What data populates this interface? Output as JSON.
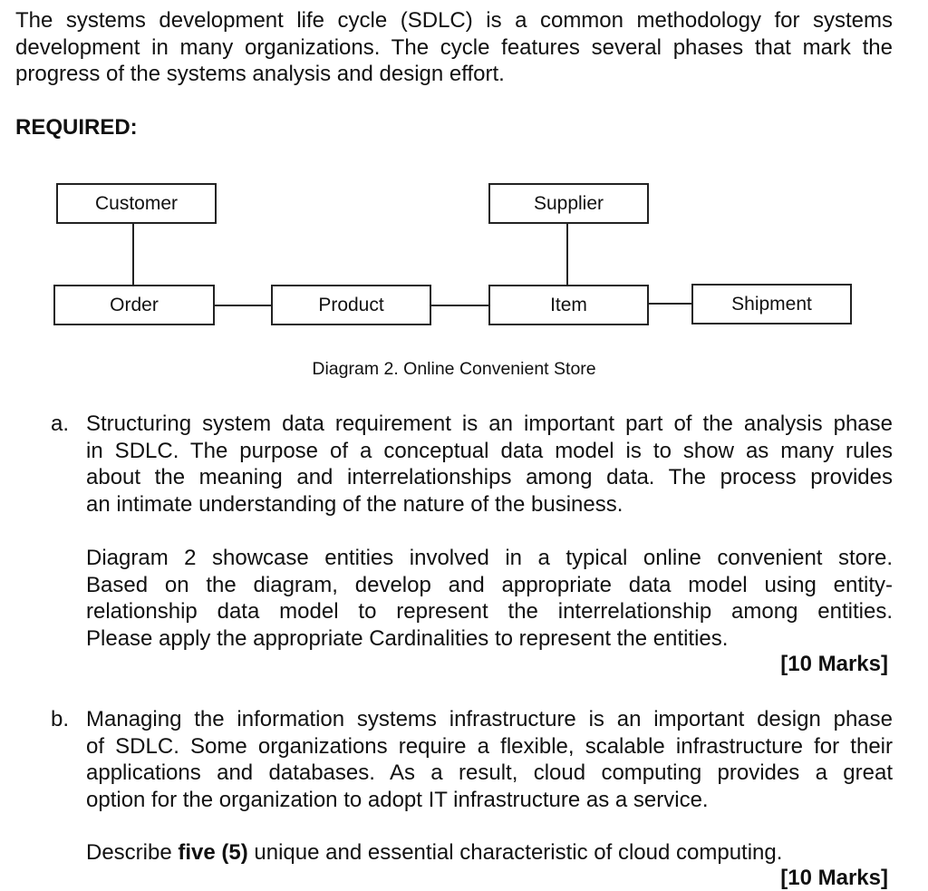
{
  "intro": {
    "line1": "The systems development life cycle (SDLC) is a common methodology for systems",
    "line2": "development in many organizations. The cycle features several phases that mark the",
    "line3": "progress of the systems analysis and design effort."
  },
  "required_heading": "REQUIRED:",
  "diagram": {
    "entities": {
      "customer": "Customer",
      "supplier": "Supplier",
      "order": "Order",
      "product": "Product",
      "item": "Item",
      "shipment": "Shipment"
    },
    "relationships": [
      [
        "Customer",
        "Order"
      ],
      [
        "Order",
        "Product"
      ],
      [
        "Product",
        "Item"
      ],
      [
        "Supplier",
        "Item"
      ],
      [
        "Item",
        "Shipment"
      ]
    ],
    "caption": "Diagram 2. Online Convenient Store"
  },
  "question_a": {
    "label": "a.",
    "para1": {
      "line1": "Structuring system data requirement is an important part of the analysis phase",
      "line2": "in SDLC. The purpose of a conceptual data model is to show as many rules",
      "line3": "about the meaning and interrelationships among data. The process provides",
      "line4": "an intimate understanding of the nature of the business."
    },
    "para2": {
      "line1": "Diagram 2 showcase entities involved in a typical online convenient store.",
      "line2": "Based on the diagram, develop and appropriate data model using entity-",
      "line3": "relationship data model to represent the interrelationship among entities.",
      "line4": "Please apply the appropriate Cardinalities to represent the entities."
    },
    "marks": "[10 Marks]"
  },
  "question_b": {
    "label": "b.",
    "para1": {
      "line1": "Managing the information systems infrastructure is an important design phase",
      "line2": "of SDLC. Some organizations require a flexible, scalable infrastructure for their",
      "line3": "applications and databases. As a result, cloud computing provides a great",
      "line4": "option for the organization to adopt IT infrastructure as a service."
    },
    "para2": {
      "prefix": "Describe ",
      "bold": "five (5)",
      "suffix": " unique and essential characteristic of cloud computing."
    },
    "marks": "[10 Marks]"
  }
}
